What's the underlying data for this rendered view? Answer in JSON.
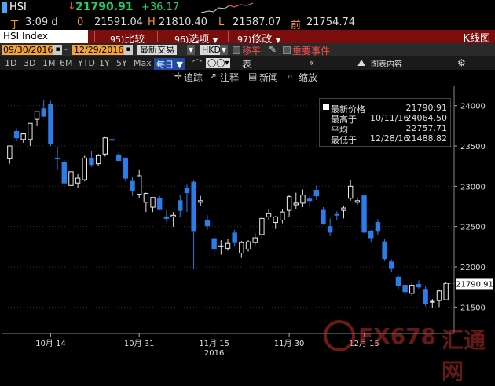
{
  "header": {
    "symbol": "HSI",
    "arrow": "↓",
    "last": "21790.91",
    "change": "+36.17"
  },
  "quote": {
    "time_label": "于",
    "time": "3:09 d",
    "open_label": "0",
    "open": "21591.04",
    "high_label": "H",
    "high": "21810.40",
    "low_label": "L",
    "low": "21587.07",
    "prev_label": "前",
    "prev": "21754.74"
  },
  "menubar": {
    "index": "HSI Index",
    "items": [
      {
        "num": "95)",
        "label": "比较"
      },
      {
        "num": "96)",
        "label": "选项"
      },
      {
        "num": "97)",
        "label": "修改"
      }
    ],
    "right": "K线图"
  },
  "range": {
    "start": "09/30/2016",
    "end": "12/29/2016",
    "mode": "最新交易",
    "currency": "HKD",
    "move": "移平",
    "events": "重要事件"
  },
  "timeframes": [
    "1D",
    "3D",
    "1M",
    "6M",
    "YTD",
    "1Y",
    "5Y",
    "Max"
  ],
  "periodicity": "每日",
  "toolbar": {
    "table": "表",
    "collapse": "«",
    "chart_content": "图表内容",
    "gear": "⚙"
  },
  "subtools": {
    "trace": "追踪",
    "annotate": "注释",
    "news": "新闻",
    "zoom": "缩放"
  },
  "legend": {
    "title": "最新价格",
    "title_value": "21790.91",
    "high_label": "最高于",
    "high_date": "10/11/16",
    "high_value": "24064.50",
    "avg_label": "平均",
    "avg_value": "22757.71",
    "low_label": "最低于",
    "low_date": "12/28/16",
    "low_value": "21488.82"
  },
  "price_tag": "21790.91",
  "watermark": "FX678",
  "watermark_cn": "汇通网",
  "colors": {
    "up": "#ffffff",
    "down": "#2b7de9",
    "accent": "#ff9a2b",
    "menubar": "#7b0d0d"
  },
  "chart_data": {
    "type": "candlestick",
    "x_ticks": [
      "10月 14",
      "10月 31",
      "11月 15",
      "11月 30",
      "12月 15"
    ],
    "x_year": "2016",
    "y_ticks": [
      "24000",
      "23500",
      "23000",
      "22500",
      "22000",
      "21500"
    ],
    "ylim": [
      21250,
      24250
    ],
    "candles": [
      {
        "o": 23340,
        "h": 23400,
        "l": 23280,
        "c": 23500
      },
      {
        "o": 23680,
        "h": 23720,
        "l": 23560,
        "c": 23600
      },
      {
        "o": 23580,
        "h": 23660,
        "l": 23540,
        "c": 23650
      },
      {
        "o": 23580,
        "h": 23720,
        "l": 23500,
        "c": 23780
      },
      {
        "o": 23830,
        "h": 23900,
        "l": 23750,
        "c": 23930
      },
      {
        "o": 23960,
        "h": 24064,
        "l": 23860,
        "c": 23870
      },
      {
        "o": 24020,
        "h": 24060,
        "l": 23500,
        "c": 23530
      },
      {
        "o": 23350,
        "h": 23480,
        "l": 23200,
        "c": 23340
      },
      {
        "o": 23300,
        "h": 23330,
        "l": 23020,
        "c": 23040
      },
      {
        "o": 23010,
        "h": 23210,
        "l": 22950,
        "c": 23180
      },
      {
        "o": 23040,
        "h": 23150,
        "l": 22980,
        "c": 23100
      },
      {
        "o": 23080,
        "h": 23380,
        "l": 23060,
        "c": 23350
      },
      {
        "o": 23340,
        "h": 23440,
        "l": 23240,
        "c": 23270
      },
      {
        "o": 23280,
        "h": 23400,
        "l": 23250,
        "c": 23380
      },
      {
        "o": 23400,
        "h": 23620,
        "l": 23370,
        "c": 23600
      },
      {
        "o": 23580,
        "h": 23620,
        "l": 23520,
        "c": 23570
      },
      {
        "o": 23390,
        "h": 23420,
        "l": 23300,
        "c": 23320
      },
      {
        "o": 23340,
        "h": 23360,
        "l": 23060,
        "c": 23100
      },
      {
        "o": 23060,
        "h": 23120,
        "l": 22880,
        "c": 22940
      },
      {
        "o": 22900,
        "h": 23200,
        "l": 22850,
        "c": 23130
      },
      {
        "o": 22800,
        "h": 22920,
        "l": 22680,
        "c": 22910
      },
      {
        "o": 22740,
        "h": 22850,
        "l": 22680,
        "c": 22860
      },
      {
        "o": 22850,
        "h": 22880,
        "l": 22700,
        "c": 22710
      },
      {
        "o": 22620,
        "h": 22700,
        "l": 22560,
        "c": 22600
      },
      {
        "o": 22620,
        "h": 22680,
        "l": 22500,
        "c": 22640
      },
      {
        "o": 22820,
        "h": 22890,
        "l": 22620,
        "c": 22700
      },
      {
        "o": 22980,
        "h": 23020,
        "l": 22680,
        "c": 22920
      },
      {
        "o": 23050,
        "h": 23070,
        "l": 21970,
        "c": 22440
      },
      {
        "o": 22800,
        "h": 22880,
        "l": 22760,
        "c": 22820
      },
      {
        "o": 22580,
        "h": 22640,
        "l": 22460,
        "c": 22510
      },
      {
        "o": 22350,
        "h": 22400,
        "l": 22130,
        "c": 22220
      },
      {
        "o": 22250,
        "h": 22330,
        "l": 22150,
        "c": 22260
      },
      {
        "o": 22230,
        "h": 22350,
        "l": 22200,
        "c": 22290
      },
      {
        "o": 22420,
        "h": 22460,
        "l": 22250,
        "c": 22300
      },
      {
        "o": 22170,
        "h": 22320,
        "l": 22110,
        "c": 22300
      },
      {
        "o": 22220,
        "h": 22330,
        "l": 22190,
        "c": 22310
      },
      {
        "o": 22300,
        "h": 22420,
        "l": 22260,
        "c": 22360
      },
      {
        "o": 22400,
        "h": 22640,
        "l": 22350,
        "c": 22600
      },
      {
        "o": 22620,
        "h": 22720,
        "l": 22580,
        "c": 22660
      },
      {
        "o": 22550,
        "h": 22630,
        "l": 22470,
        "c": 22620
      },
      {
        "o": 22580,
        "h": 22720,
        "l": 22540,
        "c": 22680
      },
      {
        "o": 22700,
        "h": 22890,
        "l": 22620,
        "c": 22870
      },
      {
        "o": 22770,
        "h": 22920,
        "l": 22720,
        "c": 22790
      },
      {
        "o": 22790,
        "h": 22960,
        "l": 22740,
        "c": 22890
      },
      {
        "o": 22840,
        "h": 22880,
        "l": 22740,
        "c": 22820
      },
      {
        "o": 22950,
        "h": 23010,
        "l": 22830,
        "c": 22880
      },
      {
        "o": 22700,
        "h": 22740,
        "l": 22520,
        "c": 22540
      },
      {
        "o": 22500,
        "h": 22600,
        "l": 22380,
        "c": 22430
      },
      {
        "o": 22650,
        "h": 22690,
        "l": 22580,
        "c": 22640
      },
      {
        "o": 22700,
        "h": 22760,
        "l": 22600,
        "c": 22730
      },
      {
        "o": 22850,
        "h": 23070,
        "l": 22820,
        "c": 23000
      },
      {
        "o": 22800,
        "h": 22860,
        "l": 22770,
        "c": 22820
      },
      {
        "o": 22880,
        "h": 22890,
        "l": 22420,
        "c": 22430
      },
      {
        "o": 22440,
        "h": 22460,
        "l": 22310,
        "c": 22360
      },
      {
        "o": 22550,
        "h": 22590,
        "l": 22400,
        "c": 22440
      },
      {
        "o": 22310,
        "h": 22340,
        "l": 22070,
        "c": 22100
      },
      {
        "o": 22060,
        "h": 22090,
        "l": 21930,
        "c": 21980
      },
      {
        "o": 21870,
        "h": 21900,
        "l": 21720,
        "c": 21770
      },
      {
        "o": 21770,
        "h": 21790,
        "l": 21650,
        "c": 21690
      },
      {
        "o": 21670,
        "h": 21800,
        "l": 21640,
        "c": 21770
      },
      {
        "o": 21780,
        "h": 21830,
        "l": 21730,
        "c": 21750
      },
      {
        "o": 21720,
        "h": 21760,
        "l": 21510,
        "c": 21540
      },
      {
        "o": 21560,
        "h": 21600,
        "l": 21490,
        "c": 21570
      },
      {
        "o": 21580,
        "h": 21720,
        "l": 21500,
        "c": 21700
      },
      {
        "o": 21590,
        "h": 21810,
        "l": 21587,
        "c": 21791
      }
    ]
  }
}
